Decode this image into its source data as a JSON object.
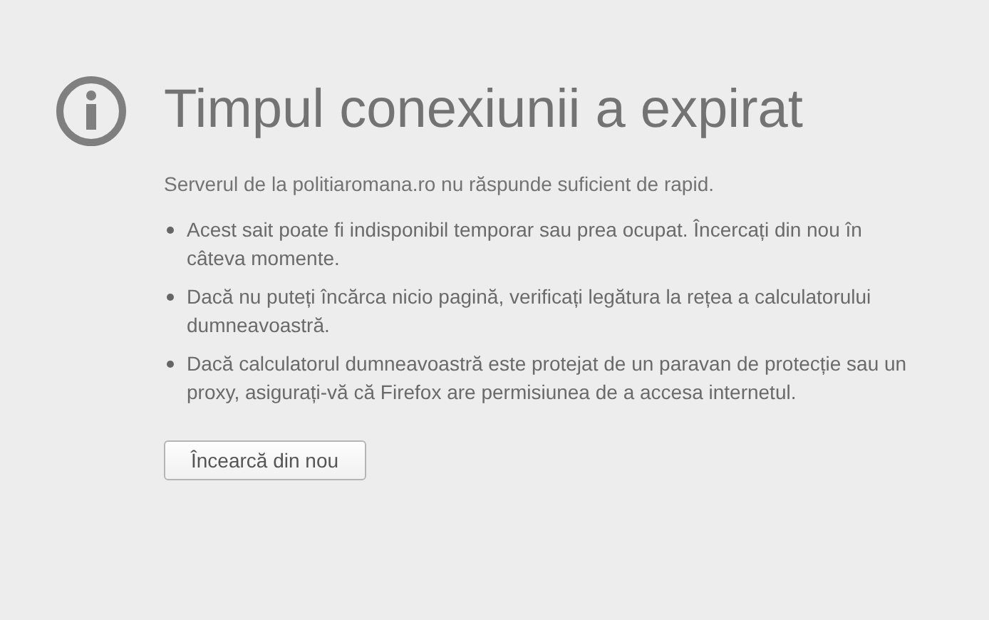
{
  "title": "Timpul conexiunii a expirat",
  "description": "Serverul de la politiaromana.ro nu răspunde suficient de rapid.",
  "suggestions": [
    "Acest sait poate fi indisponibil temporar sau prea ocupat. Încercați din nou în câteva momente.",
    "Dacă nu puteți încărca nicio pagină, verificați legătura la rețea a calculatorului dumneavoastră.",
    "Dacă calculatorul dumneavoastră este protejat de un paravan de protecție sau un proxy, asigurați-vă că Firefox are permisiunea de a accesa internetul."
  ],
  "button": "Încearcă din nou"
}
